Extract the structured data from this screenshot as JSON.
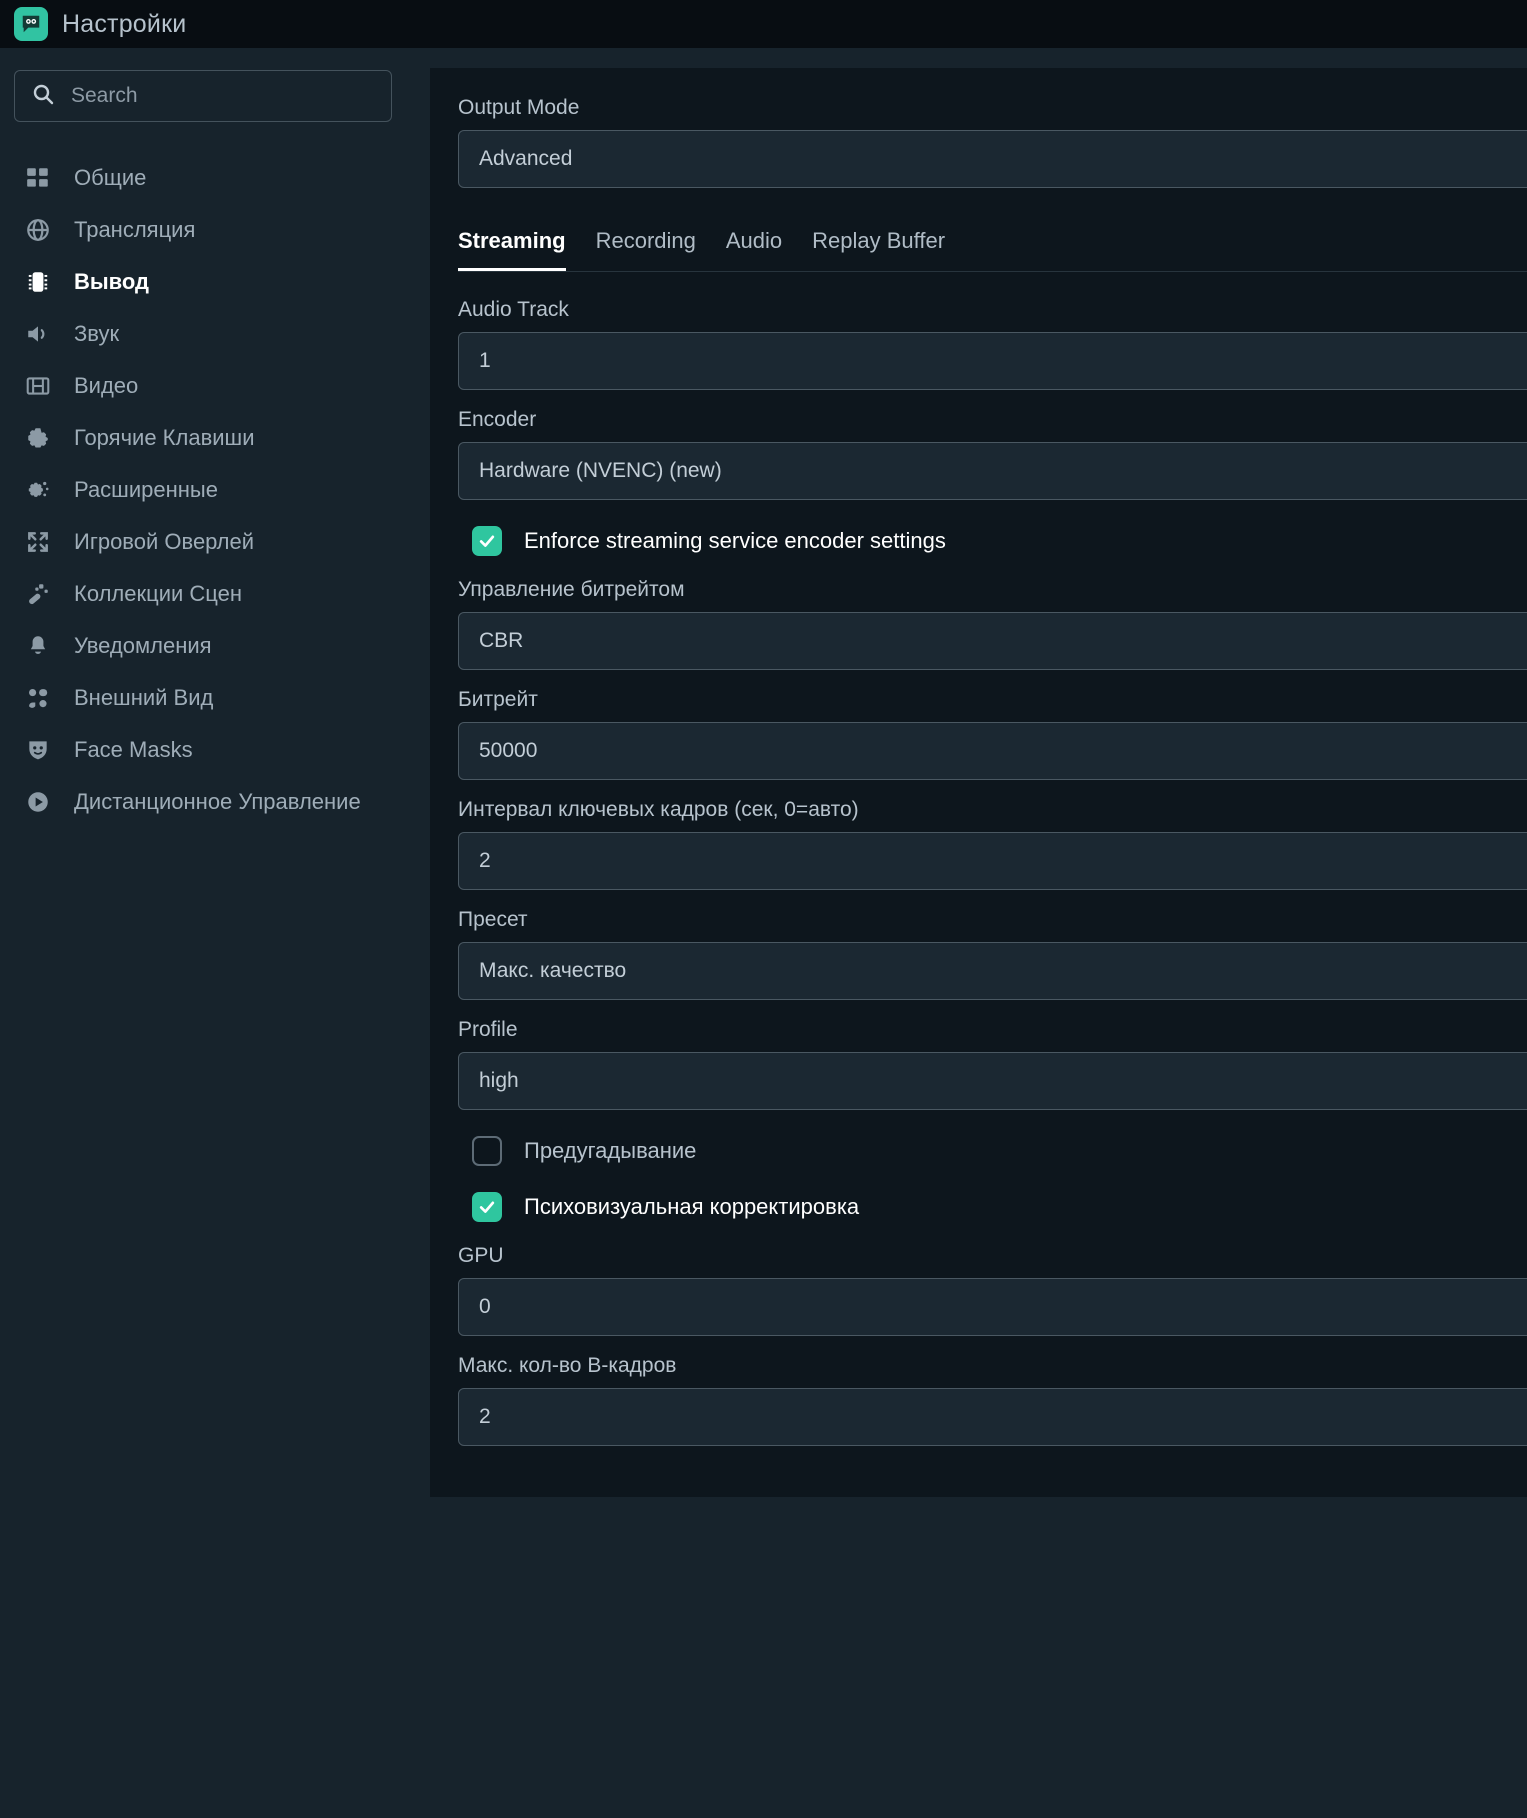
{
  "titlebar": {
    "title": "Настройки",
    "icon": "streamlabs-logo-icon"
  },
  "search": {
    "placeholder": "Search",
    "value": "",
    "icon": "search-icon"
  },
  "sidebar": {
    "items": [
      {
        "label": "Общие",
        "icon": "grid-icon",
        "active": false
      },
      {
        "label": "Трансляция",
        "icon": "globe-icon",
        "active": false
      },
      {
        "label": "Вывод",
        "icon": "chip-icon",
        "active": true
      },
      {
        "label": "Звук",
        "icon": "speaker-icon",
        "active": false
      },
      {
        "label": "Видео",
        "icon": "film-icon",
        "active": false
      },
      {
        "label": "Горячие Клавиши",
        "icon": "gear-icon",
        "active": false
      },
      {
        "label": "Расширенные",
        "icon": "gears-icon",
        "active": false
      },
      {
        "label": "Игровой Оверлей",
        "icon": "expand-icon",
        "active": false
      },
      {
        "label": "Коллекции Сцен",
        "icon": "wand-icon",
        "active": false
      },
      {
        "label": "Уведомления",
        "icon": "bell-icon",
        "active": false
      },
      {
        "label": "Внешний Вид",
        "icon": "people-icon",
        "active": false
      },
      {
        "label": "Face Masks",
        "icon": "mask-icon",
        "active": false
      },
      {
        "label": "Дистанционное Управление",
        "icon": "play-circle-icon",
        "active": false
      }
    ]
  },
  "main": {
    "output_mode": {
      "label": "Output Mode",
      "value": "Advanced"
    },
    "tabs": [
      {
        "label": "Streaming",
        "active": true
      },
      {
        "label": "Recording",
        "active": false
      },
      {
        "label": "Audio",
        "active": false
      },
      {
        "label": "Replay Buffer",
        "active": false
      }
    ],
    "fields": {
      "audio_track": {
        "label": "Audio Track",
        "value": "1"
      },
      "encoder": {
        "label": "Encoder",
        "value": "Hardware (NVENC) (new)"
      },
      "enforce": {
        "label": "Enforce streaming service encoder settings",
        "checked": true
      },
      "rate_control": {
        "label": "Управление битрейтом",
        "value": "CBR"
      },
      "bitrate": {
        "label": "Битрейт",
        "value": "50000"
      },
      "keyframe": {
        "label": "Интервал ключевых кадров (сек, 0=авто)",
        "value": "2"
      },
      "preset": {
        "label": "Пресет",
        "value": "Макс. качество"
      },
      "profile": {
        "label": "Profile",
        "value": "high"
      },
      "lookahead": {
        "label": "Предугадывание",
        "checked": false
      },
      "psycho": {
        "label": "Психовизуальная корректировка",
        "checked": true
      },
      "gpu": {
        "label": "GPU",
        "value": "0"
      },
      "bframes": {
        "label": "Макс. кол-во B-кадров",
        "value": "2"
      }
    }
  },
  "colors": {
    "accent": "#2fc69f",
    "titlebar_bg": "#080d12",
    "sidebar_bg": "#17232c",
    "panel_bg": "#0d161d",
    "control_border": "#4a5862"
  }
}
